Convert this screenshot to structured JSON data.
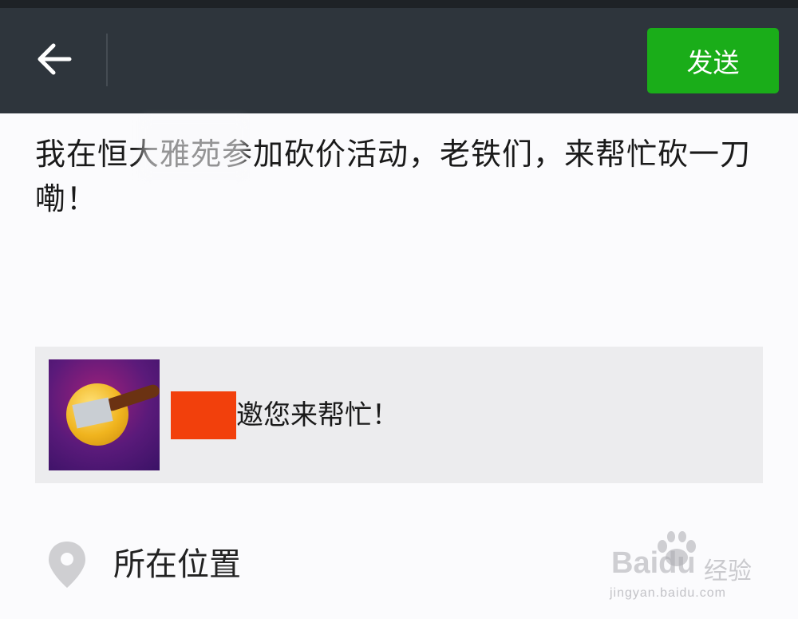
{
  "topbar": {
    "send_label": "发送"
  },
  "post": {
    "text": "我在恒大雅苑参加砍价活动，老铁们，来帮忙砍一刀嘞！"
  },
  "share_card": {
    "text": "邀您来帮忙！"
  },
  "location": {
    "label": "所在位置"
  },
  "watermark": {
    "brand": "Baidu",
    "brand_cn": "经验",
    "url": "jingyan.baidu.com"
  },
  "colors": {
    "topbar": "#2e353c",
    "send_button": "#1aad19",
    "redaction": "#f2400c"
  },
  "icons": {
    "back": "back-arrow-icon",
    "location": "location-pin-icon"
  }
}
